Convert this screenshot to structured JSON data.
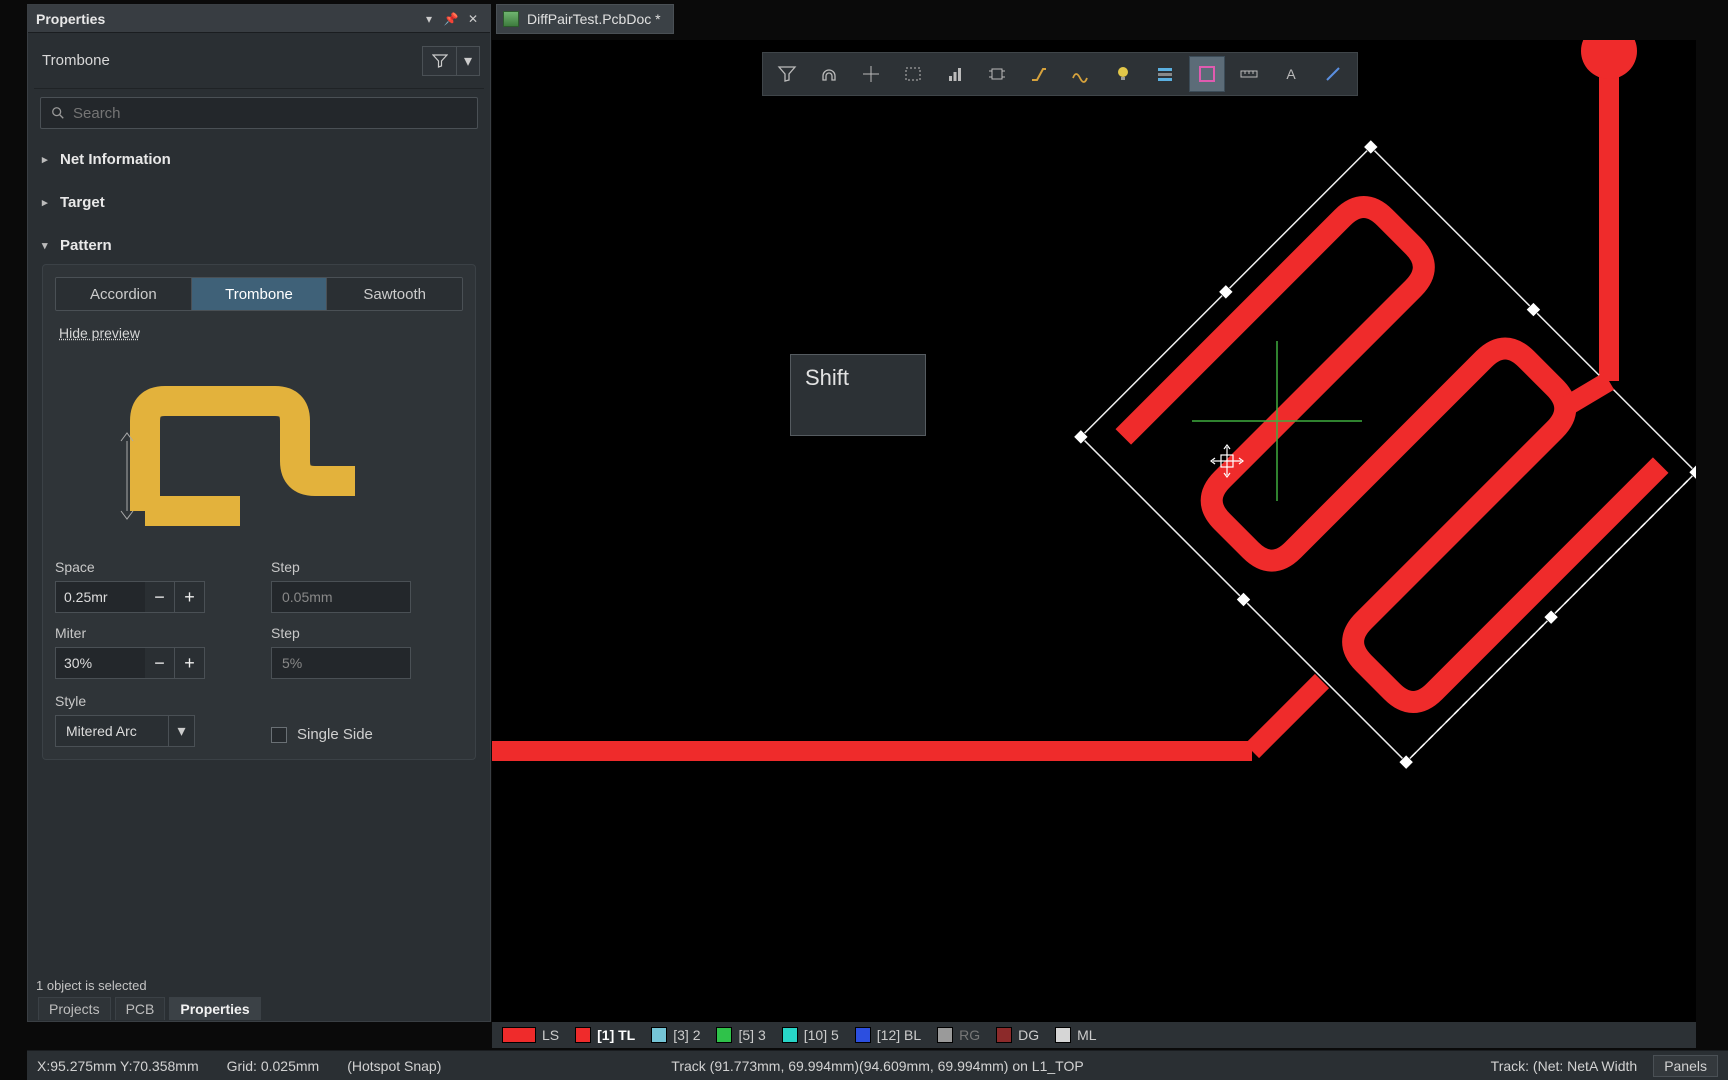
{
  "panel": {
    "title": "Properties",
    "object_type": "Trombone",
    "search_placeholder": "Search",
    "sections": {
      "net_info": "Net Information",
      "target": "Target",
      "pattern": "Pattern"
    },
    "pattern": {
      "tabs": {
        "accordion": "Accordion",
        "trombone": "Trombone",
        "sawtooth": "Sawtooth"
      },
      "active_tab": "trombone",
      "hide_preview": "Hide preview",
      "space_label": "Space",
      "space_value": "0.25mr",
      "space_step_label": "Step",
      "space_step_value": "0.05mm",
      "miter_label": "Miter",
      "miter_value": "30%",
      "miter_step_label": "Step",
      "miter_step_value": "5%",
      "style_label": "Style",
      "style_value": "Mitered Arc",
      "single_side_label": "Single Side",
      "single_side_checked": false
    },
    "selection_status": "1 object is selected",
    "bottom_tabs": {
      "projects": "Projects",
      "pcb": "PCB",
      "properties": "Properties",
      "active": "properties"
    }
  },
  "document": {
    "tab_label": "DiffPairTest.PcbDoc *"
  },
  "toolbar": {
    "items": [
      {
        "name": "filter-icon",
        "active": false
      },
      {
        "name": "snap-icon",
        "active": false
      },
      {
        "name": "crosshair-icon",
        "active": false
      },
      {
        "name": "rectangle-icon",
        "active": false
      },
      {
        "name": "align-icon",
        "active": false
      },
      {
        "name": "component-icon",
        "active": false
      },
      {
        "name": "route-icon",
        "active": false
      },
      {
        "name": "diffpair-icon",
        "active": false
      },
      {
        "name": "bulb-icon",
        "active": false
      },
      {
        "name": "layerstack-icon",
        "active": false
      },
      {
        "name": "highlight-icon",
        "active": true
      },
      {
        "name": "measure-icon",
        "active": false
      },
      {
        "name": "text-icon",
        "active": false
      },
      {
        "name": "line-icon",
        "active": false
      }
    ]
  },
  "key_indicator": "Shift",
  "layers": [
    {
      "color": "#ef2b2b",
      "label": "LS",
      "wide": true
    },
    {
      "color": "#ef2b2b",
      "label": "[1] TL"
    },
    {
      "color": "#75c5d6",
      "label": "[3] 2"
    },
    {
      "color": "#2fc24a",
      "label": "[5] 3"
    },
    {
      "color": "#28d6c8",
      "label": "[10] 5"
    },
    {
      "color": "#2c4fe0",
      "label": "[12] BL"
    },
    {
      "color": "#9a9a9a",
      "label": "RG",
      "dim": true
    },
    {
      "color": "#8c2a2a",
      "label": "DG"
    },
    {
      "color": "#d6d6d6",
      "label": "ML"
    }
  ],
  "status": {
    "coords": "X:95.275mm Y:70.358mm",
    "grid": "Grid: 0.025mm",
    "snap": "(Hotspot Snap)",
    "center": "Track (91.773mm, 69.994mm)(94.609mm, 69.994mm) on L1_TOP",
    "right_info": "Track: (Net: NetA Width",
    "panels_btn": "Panels"
  }
}
